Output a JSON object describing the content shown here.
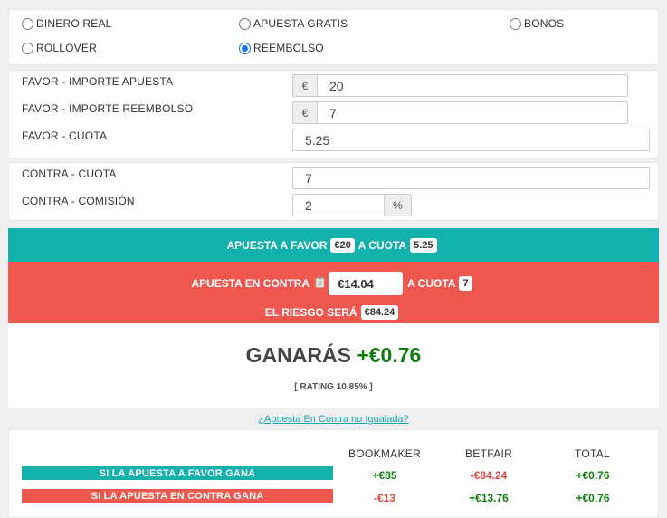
{
  "modes": {
    "dinero_real": "DINERO REAL",
    "apuesta_gratis": "APUESTA GRATIS",
    "bonos": "BONOS",
    "rollover": "ROLLOVER",
    "reembolso": "REEMBOLSO",
    "selected": "REEMBOLSO"
  },
  "favor": {
    "importe_label": "FAVOR - IMPORTE APUESTA",
    "importe_currency": "€",
    "importe_value": "20",
    "reembolso_label": "FAVOR - IMPORTE REEMBOLSO",
    "reembolso_currency": "€",
    "reembolso_value": "7",
    "cuota_label": "FAVOR - CUOTA",
    "cuota_value": "5.25"
  },
  "contra": {
    "cuota_label": "CONTRA - CUOTA",
    "cuota_value": "7",
    "comision_label": "CONTRA - COMISIÓN",
    "comision_value": "2",
    "comision_unit": "%"
  },
  "summary": {
    "favor_text": "APUESTA A FAVOR",
    "favor_amount": "€20",
    "a_cuota_1": "A CUOTA",
    "favor_cuota": "5.25",
    "contra_text": "APUESTA EN CONTRA",
    "contra_amount": "€14.04",
    "a_cuota_2": "A CUOTA",
    "contra_cuota": "7",
    "riesgo_text": "EL RIESGO SERÁ",
    "riesgo_amount": "€84.24"
  },
  "result": {
    "ganaras": "GANARÁS",
    "profit": "+€0.76",
    "rating": "[ RATING 10.85% ]"
  },
  "link_text": "¿Apuesta En Contra no Igualada?",
  "table": {
    "headers": [
      "BOOKMAKER",
      "BETFAIR",
      "TOTAL"
    ],
    "rows": [
      {
        "label": "SI LA APUESTA A FAVOR GANA",
        "bookmaker": "+€85",
        "betfair": "-€84.24",
        "total": "+€0.76"
      },
      {
        "label": "SI LA APUESTA EN CONTRA GANA",
        "bookmaker": "-€13",
        "betfair": "+€13.76",
        "total": "+€0.76"
      }
    ]
  },
  "colors": {
    "teal": "#12b1ab",
    "red": "#f0584f",
    "green": "#0e7d0e",
    "negative": "#e0453b",
    "radio_selected": "#1a73e8"
  }
}
